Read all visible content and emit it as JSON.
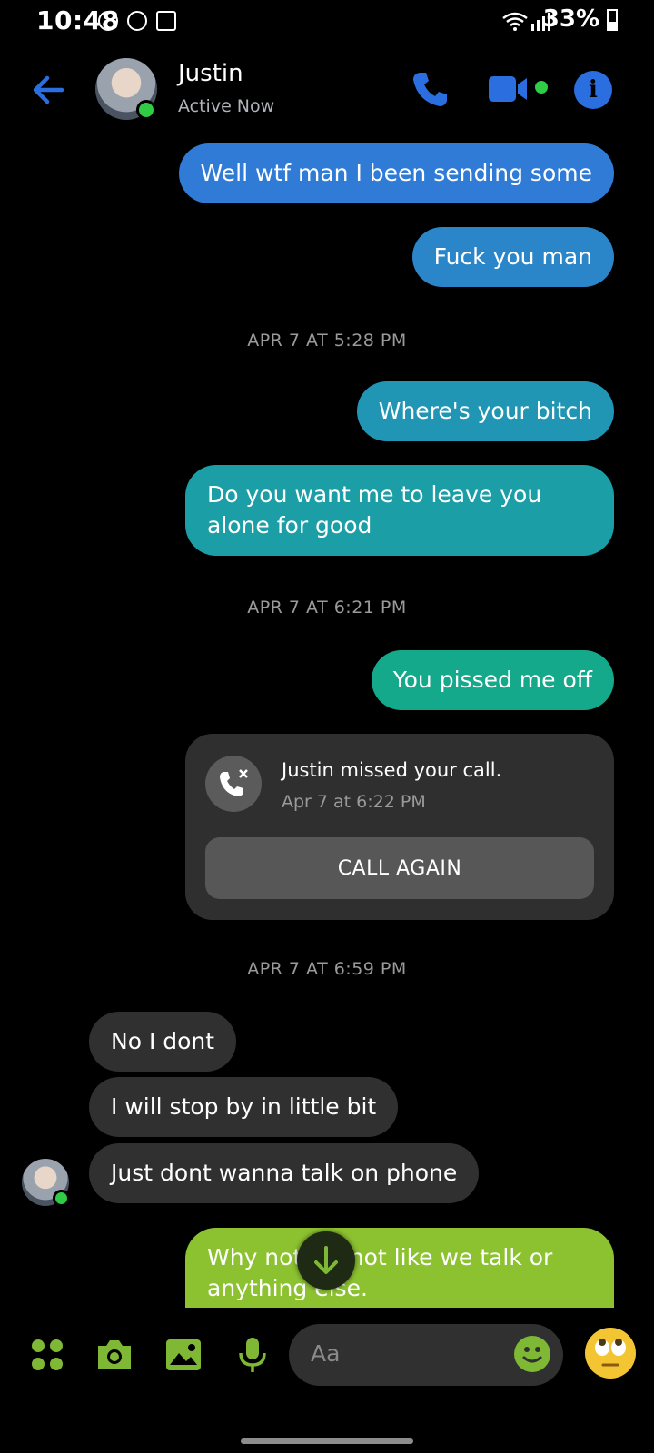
{
  "status_bar": {
    "time": "10:48",
    "battery": "33%"
  },
  "header": {
    "name": "Justin",
    "status": "Active Now"
  },
  "colors": {
    "accent": "#2b6ee0",
    "presence": "#31cc46",
    "composer_accent": "#7fb834"
  },
  "messages": {
    "m1": "Well wtf man I been sending some",
    "m2": "Fuck you man",
    "ts1": "APR 7 AT 5:28 PM",
    "m3": "Where's your bitch",
    "m4": "Do you want me to leave you alone for good",
    "ts2": "APR 7 AT 6:21 PM",
    "m5": "You pissed me off",
    "ts3": "APR 7 AT 6:59 PM",
    "r1": "No I dont",
    "r2": "I will stop by in little  bit",
    "r3": "Just dont wanna talk on phone",
    "m6": "Why not it's not like we talk or anything else."
  },
  "missed_call": {
    "title": "Justin missed your call.",
    "time": "Apr 7 at 6:22 PM",
    "button": "CALL AGAIN"
  },
  "composer": {
    "placeholder": "Aa"
  },
  "icons": [
    "back-arrow-icon",
    "phone-icon",
    "video-camera-icon",
    "info-icon",
    "menu-dots-icon",
    "camera-icon",
    "image-icon",
    "microphone-icon",
    "emoji-icon",
    "eye-roll-emoji-icon",
    "arrow-down-icon",
    "missed-call-icon"
  ]
}
